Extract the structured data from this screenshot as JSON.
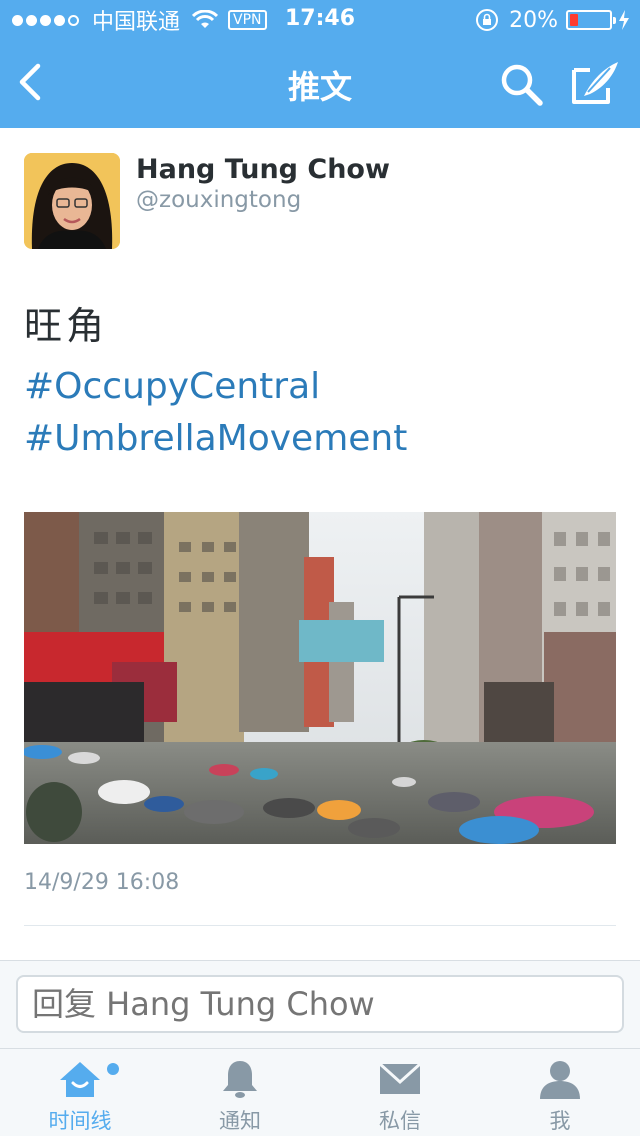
{
  "status_bar": {
    "carrier": "中国联通",
    "vpn": "VPN",
    "time": "17:46",
    "battery_percent": "20%",
    "battery_level": 0.2
  },
  "nav": {
    "title": "推文"
  },
  "tweet": {
    "author_name": "Hang Tung Chow",
    "author_handle": "@zouxingtong",
    "text": "旺角",
    "hashtags": [
      "#OccupyCentral",
      "#UmbrellaMovement"
    ],
    "timestamp": "14/9/29 16:08"
  },
  "reply": {
    "placeholder": "回复 Hang Tung Chow"
  },
  "tabbar": {
    "items": [
      {
        "label": "时间线",
        "icon": "home-icon",
        "active": true,
        "has_badge": true
      },
      {
        "label": "通知",
        "icon": "bell-icon",
        "active": false
      },
      {
        "label": "私信",
        "icon": "envelope-icon",
        "active": false
      },
      {
        "label": "我",
        "icon": "person-icon",
        "active": false
      }
    ]
  },
  "colors": {
    "brand": "#55acee",
    "hashtag": "#2b7bb9",
    "text": "#292f33",
    "muted": "#8899a6"
  }
}
